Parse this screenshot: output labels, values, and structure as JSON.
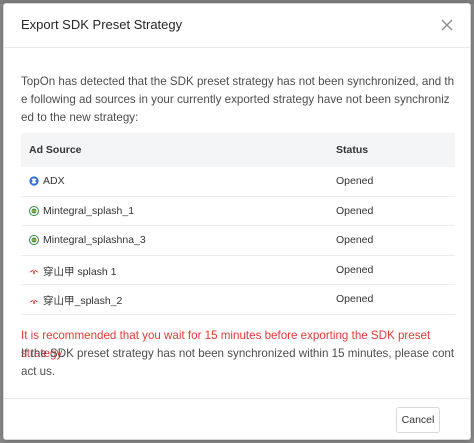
{
  "dialog": {
    "title": "Export SDK Preset Strategy",
    "intro": "TopOn has detected that the SDK preset strategy has not been synchronized, and the following ad sources in your currently exported strategy have not been synchronized to the new strategy:",
    "warning": "It is recommended that you wait for 15 minutes before exporting the SDK preset strategy.",
    "note": "If the SDK preset strategy has not been synchronized within 15 minutes, please contact us.",
    "cancel_label": "Cancel"
  },
  "table": {
    "headers": [
      "Ad Source",
      "Status"
    ],
    "rows": [
      {
        "source": "ADX",
        "status": "Opened",
        "icon": "adx-icon"
      },
      {
        "source": "Mintegral_splash_1",
        "status": "Opened",
        "icon": "mintegral-icon"
      },
      {
        "source": "Mintegral_splashna_3",
        "status": "Opened",
        "icon": "mintegral-icon"
      },
      {
        "source": "穿山甲 splash 1",
        "status": "Opened",
        "icon": "pangle-icon"
      },
      {
        "source": "穿山甲_splash_2",
        "status": "Opened",
        "icon": "pangle-icon"
      }
    ]
  },
  "colors": {
    "warning": "#e53935",
    "adx": "#2d6fd6",
    "mintegral": "#2e8b3e",
    "pangle": "#e0322b"
  }
}
